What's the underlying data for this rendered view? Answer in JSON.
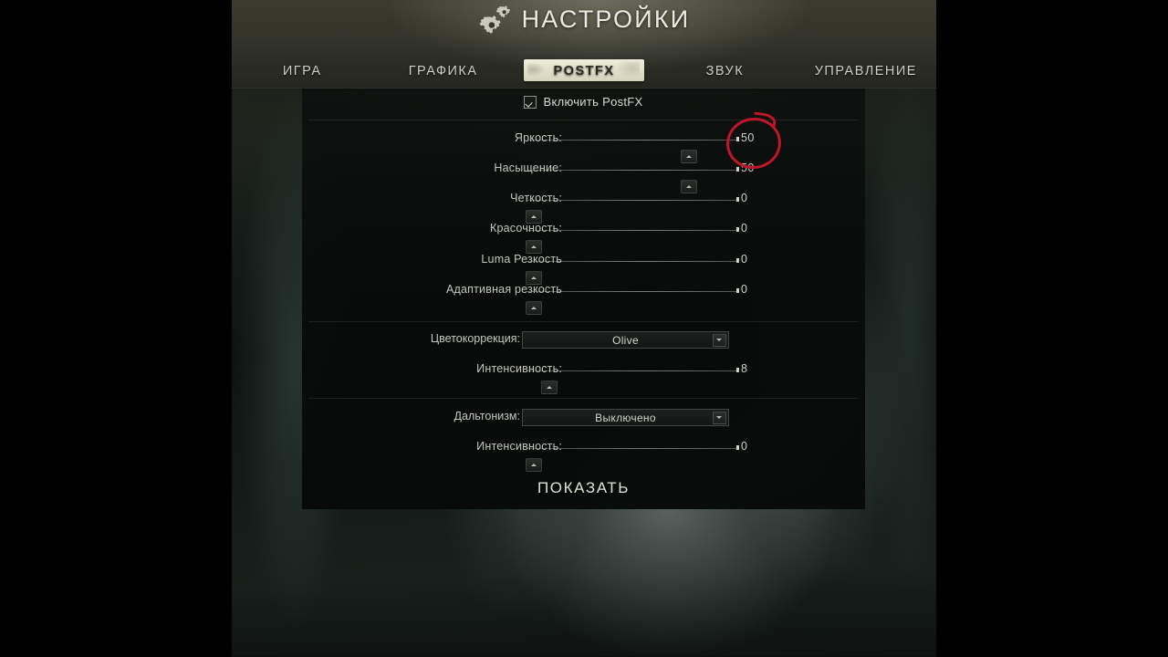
{
  "header": {
    "title": "НАСТРОЙКИ",
    "gears_icon": "gears-icon",
    "tabs": [
      {
        "label": "ИГРА",
        "active": false
      },
      {
        "label": "ГРАФИКА",
        "active": false
      },
      {
        "label": "POSTFX",
        "active": true
      },
      {
        "label": "ЗВУК",
        "active": false
      },
      {
        "label": "УПРАВЛЕНИЕ",
        "active": false
      }
    ]
  },
  "panel": {
    "enable": {
      "label": "Включить PostFX",
      "checked": true,
      "icon": "checkbox-checked-icon"
    },
    "sliders_group1": [
      {
        "label": "Яркость:",
        "value": "50",
        "pos": 73
      },
      {
        "label": "Насыщение:",
        "value": "50",
        "pos": 73
      },
      {
        "label": "Четкость:",
        "value": "0",
        "pos": 0
      },
      {
        "label": "Красочность:",
        "value": "0",
        "pos": 0
      },
      {
        "label": "Luma Резкость",
        "value": "0",
        "pos": 0
      },
      {
        "label": "Адаптивная резкость",
        "value": "0",
        "pos": 0
      }
    ],
    "color_correction": {
      "label": "Цветокоррекция:",
      "value": "Olive",
      "chevron_icon": "chevron-down-icon"
    },
    "color_intensity": {
      "label": "Интенсивность:",
      "value": "8",
      "pos": 7
    },
    "colorblind": {
      "label": "Дальтонизм:",
      "value": "Выключено",
      "chevron_icon": "chevron-down-icon"
    },
    "colorblind_intensity": {
      "label": "Интенсивность:",
      "value": "0",
      "pos": 0
    },
    "show_button": "ПОКАЗАТЬ"
  },
  "annotation": {
    "shape": "red-circle-highlight",
    "target": "Яркость value 50",
    "color": "#c0152a"
  }
}
